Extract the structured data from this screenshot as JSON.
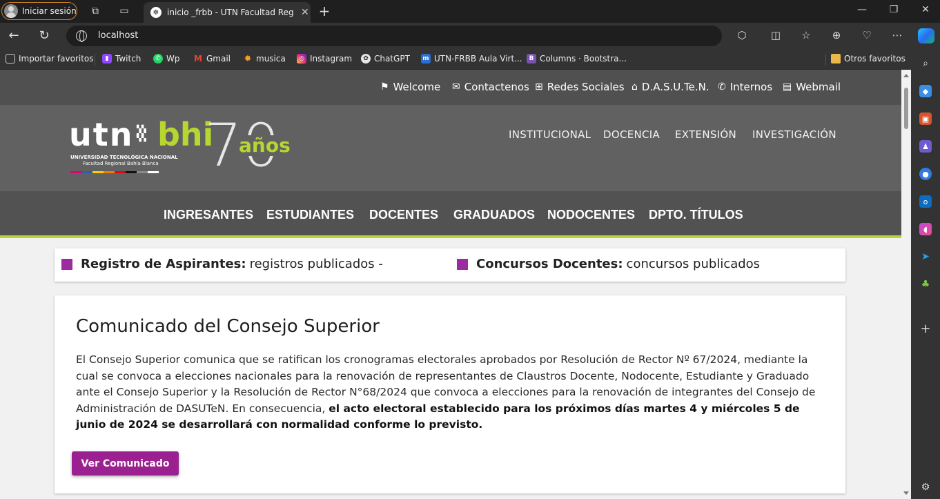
{
  "browser": {
    "profile_label": "Iniciar sesión",
    "tab_title": "inicio _frbb - UTN Facultad Regional Bahía Blanca",
    "tab_close": "✕",
    "new_tab": "+",
    "url": "localhost",
    "window_controls": [
      "—",
      "❐",
      "✕"
    ],
    "bookmarks": [
      {
        "label": "Importar favoritos",
        "icon": "import-icon",
        "color": "#555555"
      },
      {
        "label": "Twitch",
        "icon": "twitch-icon",
        "color": "#9146ff"
      },
      {
        "label": "Wp",
        "icon": "whatsapp-icon",
        "color": "#25d366"
      },
      {
        "label": "Gmail",
        "icon": "gmail-icon",
        "color": "#ea4335"
      },
      {
        "label": "musica",
        "icon": "music-icon",
        "color": "#f7a21b"
      },
      {
        "label": "Instagram",
        "icon": "instagram-icon",
        "color": "#e1306c"
      },
      {
        "label": "ChatGPT",
        "icon": "chatgpt-icon",
        "color": "#dddddd"
      },
      {
        "label": "UTN-FRBB Aula Virt...",
        "icon": "moodle-icon",
        "color": "#2a6fd6"
      },
      {
        "label": "Columns · Bootstra...",
        "icon": "bootstrap-icon",
        "color": "#7952b3"
      }
    ],
    "other_favorites": "Otros favoritos"
  },
  "site": {
    "top_links": [
      {
        "label": "Welcome",
        "icon": "flag-icon"
      },
      {
        "label": "Contactenos",
        "icon": "envelope-icon"
      },
      {
        "label": "Redes Sociales",
        "icon": "sitemap-icon"
      },
      {
        "label": "D.A.S.U.Te.N.",
        "icon": "home-icon"
      },
      {
        "label": "Internos",
        "icon": "phone-icon"
      },
      {
        "label": "Webmail",
        "icon": "inbox-icon"
      }
    ],
    "logo": {
      "utn": "utn",
      "bhi": "bhi",
      "line1": "UNIVERSIDAD TECNOLÓGICA NACIONAL",
      "line2": "Facultad Regional Bahía Blanca",
      "seventy": "70",
      "anos": "años"
    },
    "main_menu": [
      "INSTITUCIONAL",
      "DOCENCIA",
      "EXTENSIÓN",
      "INVESTIGACIÓN"
    ],
    "categories": [
      "INGRESANTES",
      "ESTUDIANTES",
      "DOCENTES",
      "GRADUADOS",
      "NODOCENTES",
      "DPTO. TÍTULOS"
    ],
    "ticker": [
      {
        "bold": "Registro de Aspirantes:",
        "text": "registros publicados -"
      },
      {
        "bold": "Concursos Docentes:",
        "text": "concursos publicados"
      }
    ],
    "announcement": {
      "title": "Comunicado del Consejo Superior",
      "body": "El Consejo Superior comunica que se ratifican los cronogramas electorales aprobados por Resolución de Rector Nº 67/2024, mediante la cual se convoca a elecciones nacionales para la renovación de representantes de Claustros Docente, Nodocente, Estudiante y Graduado ante el Consejo Superior y la Resolución de Rector N°68/2024 que convoca a elecciones para la renovación de integrantes del Consejo de Administración de DASUTeN. En consecuencia,",
      "body_bold": "el acto electoral establecido para los próximos días martes 4 y miércoles 5 de junio de 2024 se desarrollará con normalidad conforme lo previsto.",
      "button": "Ver Comunicado"
    }
  },
  "colors": {
    "accent_green": "#b6d630",
    "purple": "#9b2190",
    "topbar": "#505050",
    "header": "#616161"
  }
}
